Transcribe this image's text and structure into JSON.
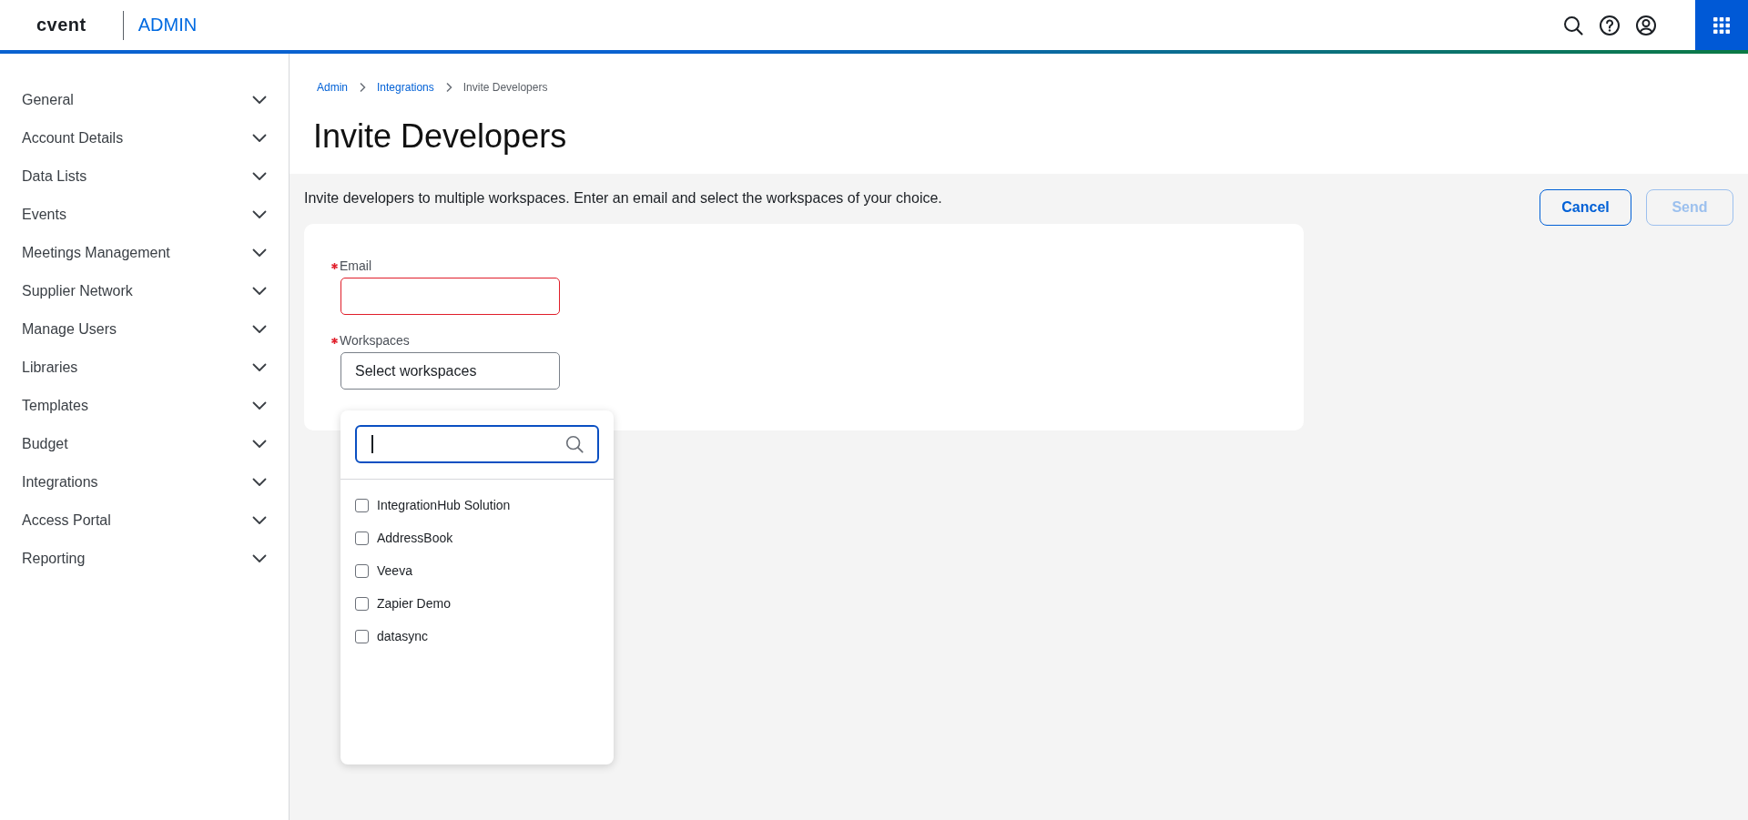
{
  "header": {
    "logo": "cvent",
    "section": "ADMIN"
  },
  "sidebar": {
    "items": [
      {
        "label": "General",
        "expanded": false
      },
      {
        "label": "Account Details",
        "expanded": false
      },
      {
        "label": "Data Lists",
        "expanded": false
      },
      {
        "label": "Events",
        "expanded": false
      },
      {
        "label": "Meetings Management",
        "expanded": false
      },
      {
        "label": "Supplier Network",
        "expanded": false
      },
      {
        "label": "Manage Users",
        "expanded": false
      },
      {
        "label": "Libraries",
        "expanded": false
      },
      {
        "label": "Templates",
        "expanded": false
      },
      {
        "label": "Budget",
        "expanded": false
      },
      {
        "label": "Integrations",
        "expanded": false
      },
      {
        "label": "Access Portal",
        "expanded": false
      },
      {
        "label": "Reporting",
        "expanded": false
      }
    ]
  },
  "breadcrumb": [
    {
      "label": "Admin",
      "kind": "link"
    },
    {
      "label": "Integrations",
      "kind": "link"
    },
    {
      "label": "Invite Developers",
      "kind": "current"
    }
  ],
  "title": "Invite Developers",
  "description": "Invite developers to multiple workspaces. Enter an email and select the workspaces of your choice.",
  "buttons": [
    {
      "label": "Cancel",
      "disabled": false
    },
    {
      "label": "Send",
      "disabled": true
    }
  ],
  "form": {
    "fields": [
      {
        "label": "Email",
        "required": true,
        "invalid": true,
        "kind": "input"
      },
      {
        "label": "Workspaces",
        "required": true,
        "invalid": false,
        "kind": "select",
        "value": "Select workspaces"
      }
    ]
  },
  "dropdown": {
    "search": {
      "focused": true
    },
    "options": [
      {
        "label": "IntegrationHub Solution",
        "checked": false
      },
      {
        "label": "AddressBook",
        "checked": false
      },
      {
        "label": "Veeva",
        "checked": false
      },
      {
        "label": "Zapier Demo",
        "checked": false
      },
      {
        "label": "datasync",
        "checked": false
      }
    ]
  }
}
